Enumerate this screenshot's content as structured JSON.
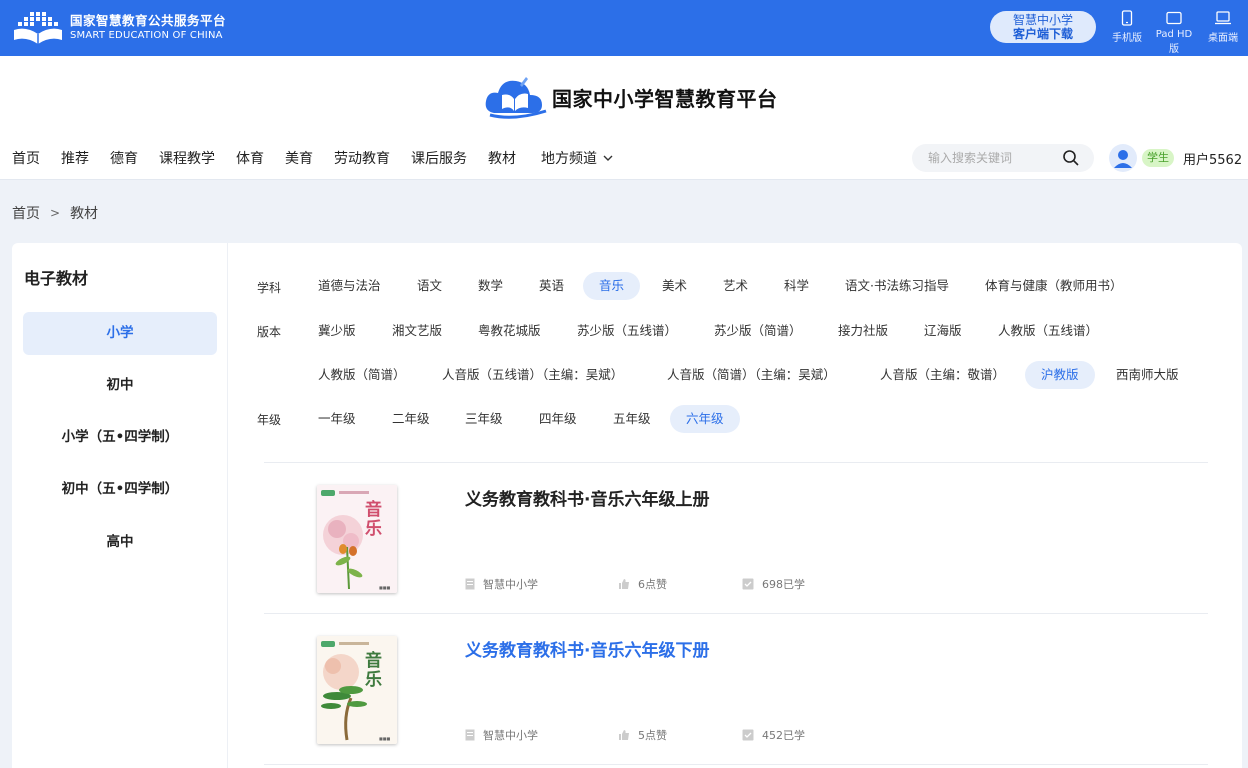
{
  "topbar": {
    "brand_cn": "国家智慧教育公共服务平台",
    "brand_en": "SMART EDUCATION OF CHINA",
    "download_line1": "智慧中小学",
    "download_line2": "客户端下载",
    "devices": [
      "手机版",
      "Pad HD版",
      "桌面端"
    ]
  },
  "header": {
    "site_title": "国家中小学智慧教育平台",
    "nav": [
      "首页",
      "推荐",
      "德育",
      "课程教学",
      "体育",
      "美育",
      "劳动教育",
      "课后服务",
      "教材",
      "地方频道"
    ],
    "search_placeholder": "输入搜索关键词",
    "role_badge": "学生",
    "username": "用户5562"
  },
  "breadcrumb": [
    "首页",
    "教材"
  ],
  "sidebar": {
    "title": "电子教材",
    "items": [
      "小学",
      "初中",
      "小学（五•四学制）",
      "初中（五•四学制）",
      "高中"
    ],
    "active_index": 0
  },
  "filters": {
    "subject_label": "学科",
    "subjects": [
      "道德与法治",
      "语文",
      "数学",
      "英语",
      "音乐",
      "美术",
      "艺术",
      "科学",
      "语文·书法练习指导",
      "体育与健康（教师用书）"
    ],
    "subject_active": "音乐",
    "edition_label": "版本",
    "editions_row1": [
      "冀少版",
      "湘文艺版",
      "粤教花城版",
      "苏少版（五线谱）",
      "苏少版（简谱）",
      "接力社版",
      "辽海版",
      "人教版（五线谱）"
    ],
    "editions_row2": [
      "人教版（简谱）",
      "人音版（五线谱）（主编：吴斌）",
      "人音版（简谱）（主编：吴斌）",
      "人音版（主编：敬谱）",
      "沪教版",
      "西南师大版"
    ],
    "edition_active": "沪教版",
    "grade_label": "年级",
    "grades": [
      "一年级",
      "二年级",
      "三年级",
      "四年级",
      "五年级",
      "六年级"
    ],
    "grade_active": "六年级"
  },
  "books": [
    {
      "title": "义务教育教科书·音乐六年级上册",
      "cover_title": "音乐",
      "publisher": "智慧中小学",
      "likes": "6点赞",
      "learners": "698已学"
    },
    {
      "title": "义务教育教科书·音乐六年级下册",
      "cover_title": "音乐",
      "publisher": "智慧中小学",
      "likes": "5点赞",
      "learners": "452已学"
    }
  ],
  "colors": {
    "primary": "#2c6fe8",
    "active_bg": "#e6eefb",
    "badge_bg": "#d8f5c6"
  }
}
